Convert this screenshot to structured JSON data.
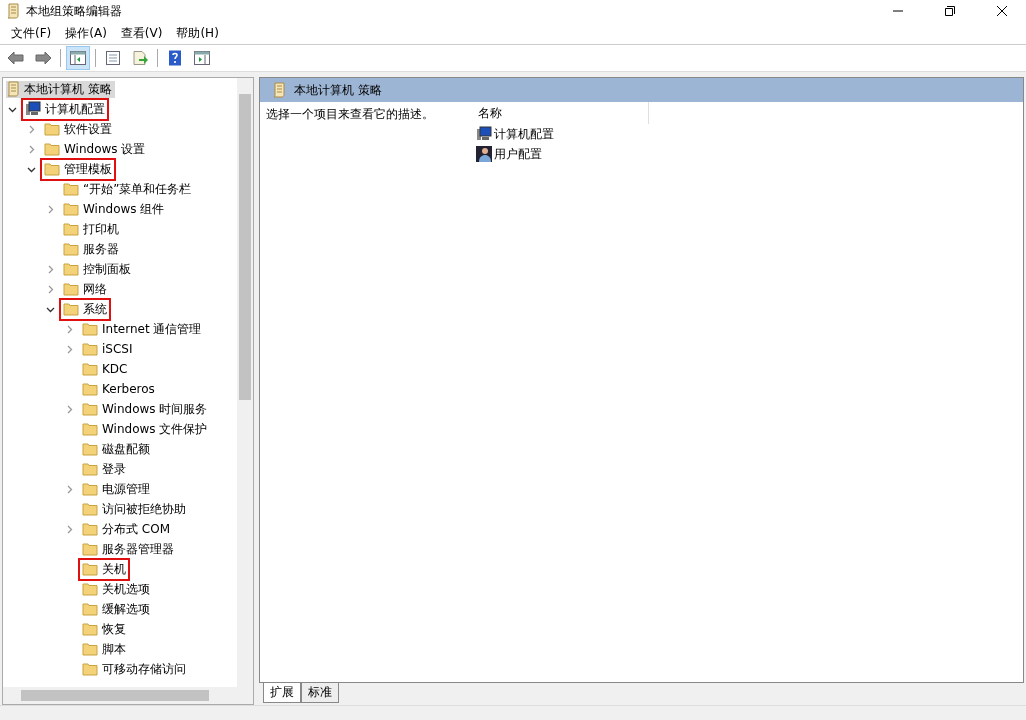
{
  "window": {
    "title": "本地组策略编辑器"
  },
  "menu": [
    "文件(F)",
    "操作(A)",
    "查看(V)",
    "帮助(H)"
  ],
  "toolbar": [
    {
      "kind": "back",
      "selected": false
    },
    {
      "kind": "forward",
      "selected": false
    },
    {
      "kind": "tree",
      "selected": true
    },
    {
      "kind": "properties",
      "selected": false
    },
    {
      "kind": "export",
      "selected": false
    },
    {
      "kind": "help",
      "selected": false
    },
    {
      "kind": "pane",
      "selected": false
    }
  ],
  "tree": {
    "label": "本地计算机 策略",
    "children": [
      {
        "label": "计算机配置",
        "expanded": true,
        "marked": true,
        "children": [
          {
            "label": "软件设置",
            "expanded": false,
            "marked": false
          },
          {
            "label": "Windows 设置",
            "expanded": false,
            "marked": false
          },
          {
            "label": "管理模板",
            "expanded": true,
            "marked": true,
            "children": [
              {
                "label": "“开始”菜单和任务栏",
                "marked": false
              },
              {
                "label": "Windows 组件",
                "expanded": false,
                "marked": false
              },
              {
                "label": "打印机",
                "marked": false
              },
              {
                "label": "服务器",
                "marked": false
              },
              {
                "label": "控制面板",
                "expanded": false,
                "marked": false
              },
              {
                "label": "网络",
                "expanded": false,
                "marked": false
              },
              {
                "label": "系统",
                "expanded": true,
                "marked": true,
                "children": [
                  {
                    "label": "Internet 通信管理",
                    "expanded": false,
                    "marked": false
                  },
                  {
                    "label": "iSCSI",
                    "expanded": false,
                    "marked": false
                  },
                  {
                    "label": "KDC",
                    "marked": false
                  },
                  {
                    "label": "Kerberos",
                    "marked": false
                  },
                  {
                    "label": "Windows 时间服务",
                    "expanded": false,
                    "marked": false
                  },
                  {
                    "label": "Windows 文件保护",
                    "marked": false
                  },
                  {
                    "label": "磁盘配额",
                    "marked": false
                  },
                  {
                    "label": "登录",
                    "marked": false
                  },
                  {
                    "label": "电源管理",
                    "expanded": false,
                    "marked": false
                  },
                  {
                    "label": "访问被拒绝协助",
                    "marked": false
                  },
                  {
                    "label": "分布式 COM",
                    "expanded": false,
                    "marked": false
                  },
                  {
                    "label": "服务器管理器",
                    "marked": false
                  },
                  {
                    "label": "关机",
                    "marked": true
                  },
                  {
                    "label": "关机选项",
                    "marked": false
                  },
                  {
                    "label": "缓解选项",
                    "marked": false
                  },
                  {
                    "label": "恢复",
                    "marked": false
                  },
                  {
                    "label": "脚本",
                    "marked": false
                  },
                  {
                    "label": "可移动存储访问",
                    "marked": false
                  }
                ]
              }
            ]
          }
        ]
      }
    ]
  },
  "details": {
    "header": "本地计算机 策略",
    "description": "选择一个项目来查看它的描述。",
    "column": "名称",
    "items": [
      "计算机配置",
      "用户配置"
    ]
  },
  "tabs": [
    {
      "label": "扩展",
      "selected": true
    },
    {
      "label": "标准",
      "selected": false
    }
  ]
}
